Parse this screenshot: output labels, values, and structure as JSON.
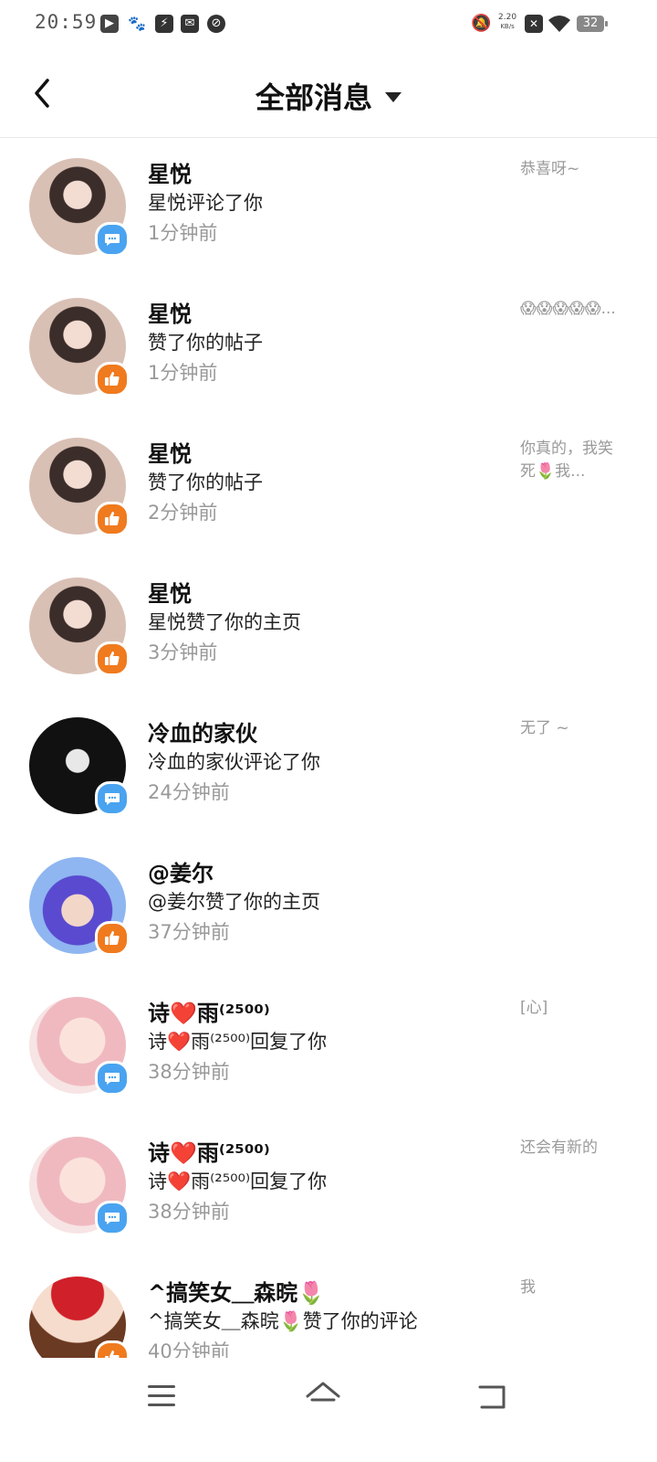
{
  "status_bar": {
    "time": "20:59",
    "net_speed_value": "2.20",
    "net_speed_unit": "KB/s",
    "battery": "32"
  },
  "header": {
    "title": "全部消息"
  },
  "messages": [
    {
      "name": "星悦",
      "action": "星悦评论了你",
      "time": "1分钟前",
      "preview": "恭喜呀~",
      "badge": "comment-icon",
      "avatar_style": "photo-girl"
    },
    {
      "name": "星悦",
      "action": "赞了你的帖子",
      "time": "1分钟前",
      "preview": "😱😱😱😱😱...",
      "badge": "like-icon",
      "avatar_style": "photo-girl"
    },
    {
      "name": "星悦",
      "action": "赞了你的帖子",
      "time": "2分钟前",
      "preview": "你真的，我笑死🌷我...",
      "badge": "like-icon",
      "avatar_style": "photo-girl"
    },
    {
      "name": "星悦",
      "action": "星悦赞了你的主页",
      "time": "3分钟前",
      "preview": "",
      "badge": "like-icon",
      "avatar_style": "photo-girl"
    },
    {
      "name": "冷血的家伙",
      "action": "冷血的家伙评论了你",
      "time": "24分钟前",
      "preview": "无了 ~",
      "badge": "comment-icon",
      "avatar_style": "dark-anime"
    },
    {
      "name": "@姜尔",
      "action": "@姜尔赞了你的主页",
      "time": "37分钟前",
      "preview": "",
      "badge": "like-icon",
      "avatar_style": "purple-anime"
    },
    {
      "name": "诗❤️雨⁽²⁵⁰⁰⁾",
      "action": "诗❤️雨⁽²⁵⁰⁰⁾回复了你",
      "time": "38分钟前",
      "preview": "[心]",
      "badge": "comment-icon",
      "avatar_style": "pink-anime"
    },
    {
      "name": "诗❤️雨⁽²⁵⁰⁰⁾",
      "action": "诗❤️雨⁽²⁵⁰⁰⁾回复了你",
      "time": "38分钟前",
      "preview": "还会有新的",
      "badge": "comment-icon",
      "avatar_style": "pink-anime"
    },
    {
      "name": "^搞笑女＿森晥🌷",
      "action": "^搞笑女＿森晥🌷赞了你的评论",
      "time": "40分钟前",
      "preview": "我",
      "badge": "like-icon",
      "avatar_style": "red-hat-anime"
    }
  ],
  "colors": {
    "comment_badge": "#4aa3f0",
    "like_badge": "#f07a1e",
    "time_text": "#999999"
  }
}
